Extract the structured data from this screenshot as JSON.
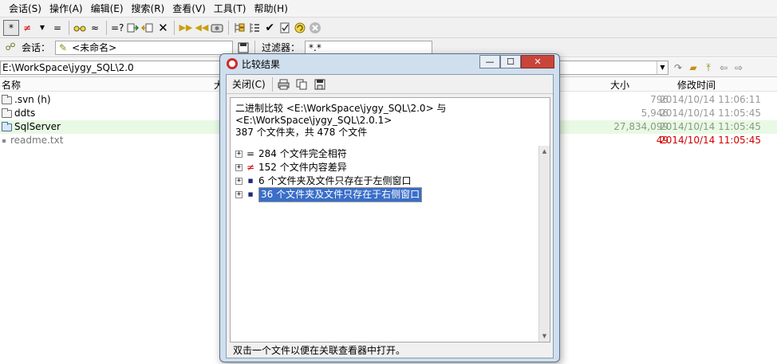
{
  "menu": [
    "会话(S)",
    "操作(A)",
    "编辑(E)",
    "搜索(R)",
    "查看(V)",
    "工具(T)",
    "帮助(H)"
  ],
  "toolbar": {
    "all_label": "*",
    "ne_label": "≠",
    "eq_label": "=",
    "approx_label": "≈",
    "eq_query_label": "=?"
  },
  "session": {
    "label": "会话：",
    "name": "<未命名>",
    "filter_label": "过滤器：",
    "filter_value": "*.*"
  },
  "path": {
    "left": "E:\\WorkSpace\\jygy_SQL\\2.0"
  },
  "columns": {
    "name": "名称",
    "size": "大小",
    "modified": "修改时间",
    "trunc": "大"
  },
  "files": [
    {
      "name": ".svn  (h)",
      "size": "796",
      "modified": "2014/10/14 11:06:11",
      "type": "folder",
      "style": "normal"
    },
    {
      "name": "ddts",
      "size": "5,946",
      "modified": "2014/10/14 11:05:45",
      "type": "folder",
      "style": "normal"
    },
    {
      "name": "SqlServer",
      "size": "27,834,099",
      "modified": "2014/10/14 11:05:45",
      "type": "folder-blue",
      "style": "green"
    },
    {
      "name": "readme.txt",
      "size": "49",
      "modified": "2014/10/14 11:05:45",
      "type": "file",
      "style": "red"
    }
  ],
  "dialog": {
    "title": "比较结果",
    "close_label": "关闭(C)",
    "summary_line1": "二进制比较 <E:\\WorkSpace\\jygy_SQL\\2.0> 与",
    "summary_line2": "<E:\\WorkSpace\\jygy_SQL\\2.0.1>",
    "summary_line3": "387 个文件夹，共 478 个文件",
    "tree": [
      {
        "marker": "=",
        "text": "284 个文件完全相符"
      },
      {
        "marker": "≠",
        "text": "152 个文件内容差异"
      },
      {
        "marker": "■",
        "text": "6 个文件夹及文件只存在于左侧窗口"
      },
      {
        "marker": "■",
        "text": "36 个文件夹及文件只存在于右侧窗口"
      }
    ],
    "status": "双击一个文件以便在关联查看器中打开。"
  },
  "colors": {
    "accent_blue": "#3a6ec8",
    "diff_red": "#d00000",
    "match_green_bg": "#e8f9e4",
    "dialog_frame": "#cfdfee"
  }
}
